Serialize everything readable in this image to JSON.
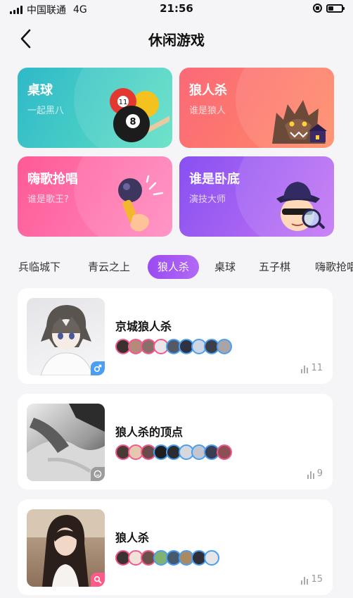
{
  "status": {
    "carrier": "中国联通",
    "network": "4G",
    "time": "21:56"
  },
  "header": {
    "title": "休闲游戏",
    "back_icon": "chevron-left-icon"
  },
  "games": [
    {
      "title": "桌球",
      "subtitle": "一起黑八",
      "icon": "billiard-8-ball-icon"
    },
    {
      "title": "狼人杀",
      "subtitle": "谁是狼人",
      "icon": "werewolf-icon"
    },
    {
      "title": "嗨歌抢唱",
      "subtitle": "谁是歌王?",
      "icon": "microphone-icon"
    },
    {
      "title": "谁是卧底",
      "subtitle": "演技大师",
      "icon": "spy-detective-icon"
    }
  ],
  "tabs": [
    {
      "label": "兵临城下"
    },
    {
      "label": "青云之上"
    },
    {
      "label": "狼人杀",
      "active": true
    },
    {
      "label": "桌球"
    },
    {
      "label": "五子棋"
    },
    {
      "label": "嗨歌抢唱"
    }
  ],
  "rooms": [
    {
      "name": "京城狼人杀",
      "count": "11",
      "badge": "male-icon"
    },
    {
      "name": "狼人杀的顶点",
      "count": "9",
      "badge": "smiley-icon"
    },
    {
      "name": "狼人杀",
      "count": "15",
      "badge": "search-icon"
    }
  ],
  "colors": {
    "accent": "#9a4bf2",
    "female_ring": "#f25a8c",
    "male_ring": "#4a9ff0"
  }
}
